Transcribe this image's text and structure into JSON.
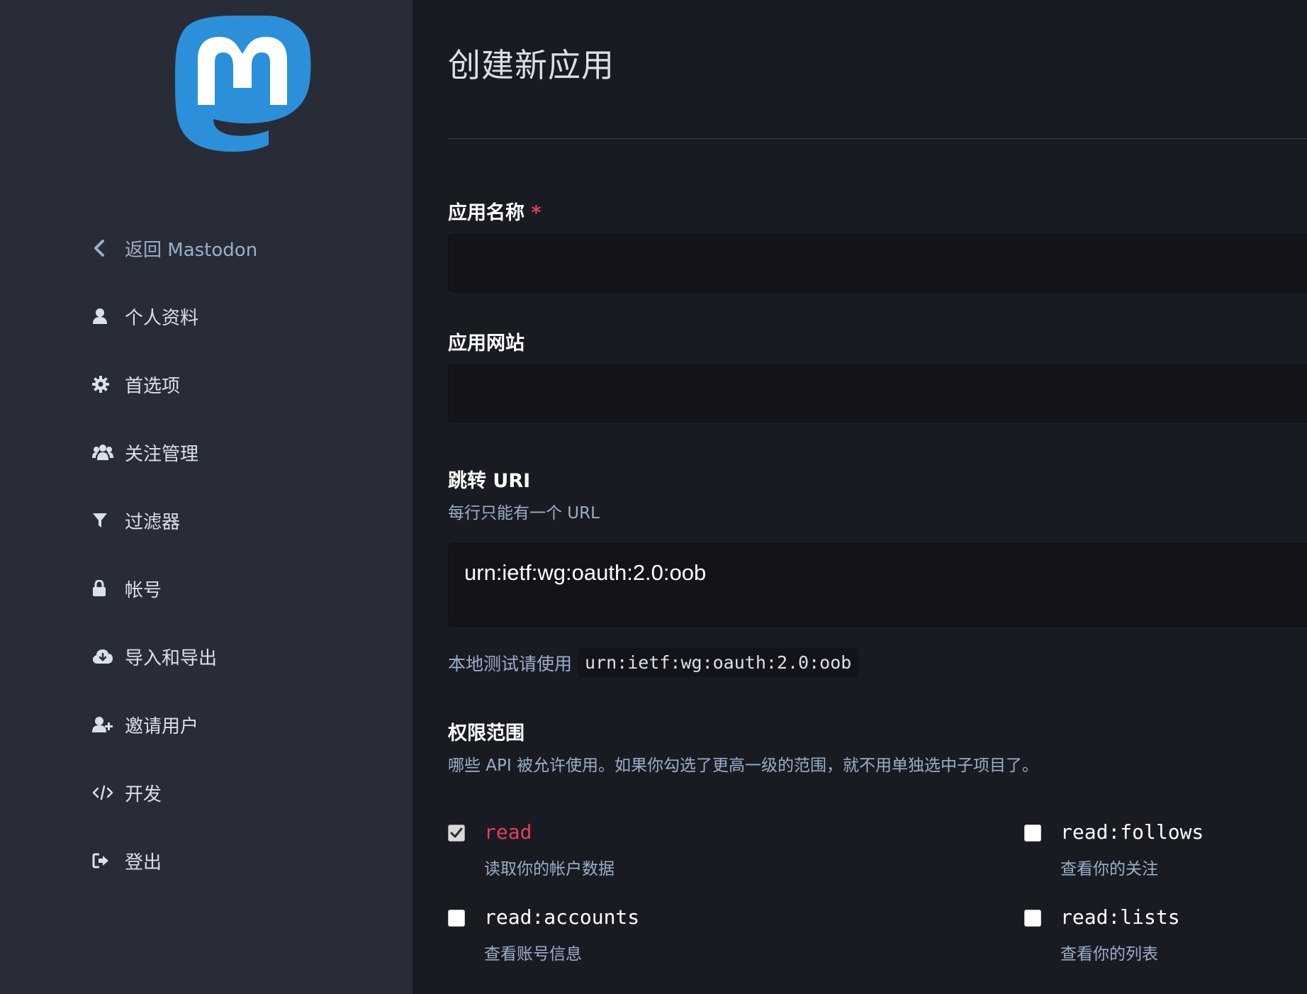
{
  "sidebar": {
    "items": [
      {
        "label": "返回 Mastodon",
        "icon": "chevron-left-icon"
      },
      {
        "label": "个人资料",
        "icon": "user-icon"
      },
      {
        "label": "首选项",
        "icon": "gear-icon"
      },
      {
        "label": "关注管理",
        "icon": "users-icon"
      },
      {
        "label": "过滤器",
        "icon": "filter-icon"
      },
      {
        "label": "帐号",
        "icon": "lock-icon"
      },
      {
        "label": "导入和导出",
        "icon": "cloud-download-icon"
      },
      {
        "label": "邀请用户",
        "icon": "user-plus-icon"
      },
      {
        "label": "开发",
        "icon": "code-icon"
      },
      {
        "label": "登出",
        "icon": "sign-out-icon"
      }
    ]
  },
  "main": {
    "title": "创建新应用",
    "app_name": {
      "label": "应用名称",
      "required_mark": "*",
      "value": ""
    },
    "app_website": {
      "label": "应用网站",
      "value": ""
    },
    "redirect_uri": {
      "label": "跳转 URI",
      "hint": "每行只能有一个 URL",
      "value": "urn:ietf:wg:oauth:2.0:oob",
      "local_hint": "本地测试请使用",
      "local_code": "urn:ietf:wg:oauth:2.0:oob"
    },
    "scopes": {
      "label": "权限范围",
      "hint": "哪些 API 被允许使用。如果你勾选了更高一级的范围，就不用单独选中子项目了。",
      "items": [
        {
          "name": "read",
          "desc": "读取你的帐户数据",
          "checked": true
        },
        {
          "name": "read:follows",
          "desc": "查看你的关注",
          "checked": false
        },
        {
          "name": "read:accounts",
          "desc": "查看账号信息",
          "checked": false
        },
        {
          "name": "read:lists",
          "desc": "查看你的列表",
          "checked": false
        }
      ]
    }
  },
  "colors": {
    "sidebar_bg": "#282c37",
    "main_bg": "#191b22",
    "brand_blue": "#2b90d9",
    "accent_red": "#df405a",
    "muted_text": "#9baec8"
  }
}
